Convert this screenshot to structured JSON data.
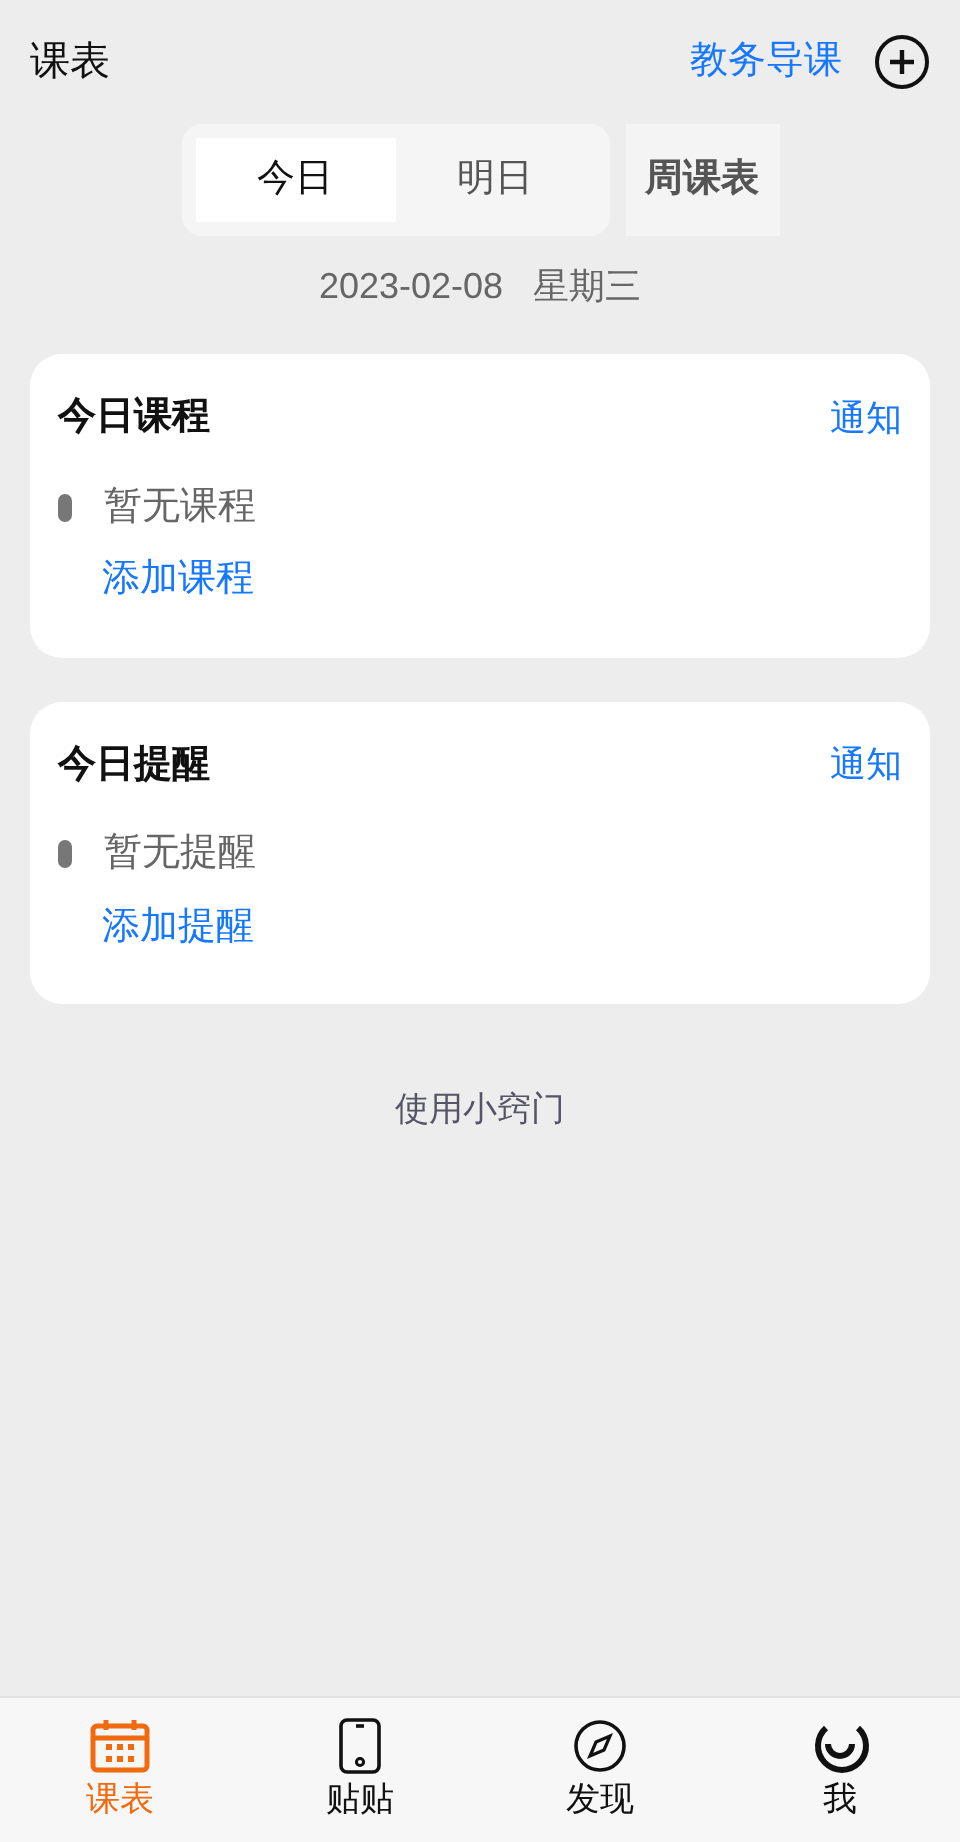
{
  "header": {
    "title": "课表",
    "link": "教务导课"
  },
  "day_tabs": [
    {
      "label": "今日",
      "selected": true
    },
    {
      "label": "明日",
      "selected": false
    }
  ],
  "week_button": "周课表",
  "date": "2023-02-08",
  "weekday": "星期三",
  "cards": [
    {
      "title": "今日课程",
      "action": "通知",
      "empty": "暂无课程",
      "add": "添加课程"
    },
    {
      "title": "今日提醒",
      "action": "通知",
      "empty": "暂无提醒",
      "add": "添加提醒"
    }
  ],
  "footer_link": "使用小窍门",
  "nav": [
    {
      "label": "课表",
      "selected": true
    },
    {
      "label": "贴贴",
      "selected": false
    },
    {
      "label": "发现",
      "selected": false
    },
    {
      "label": "我",
      "selected": false
    }
  ]
}
